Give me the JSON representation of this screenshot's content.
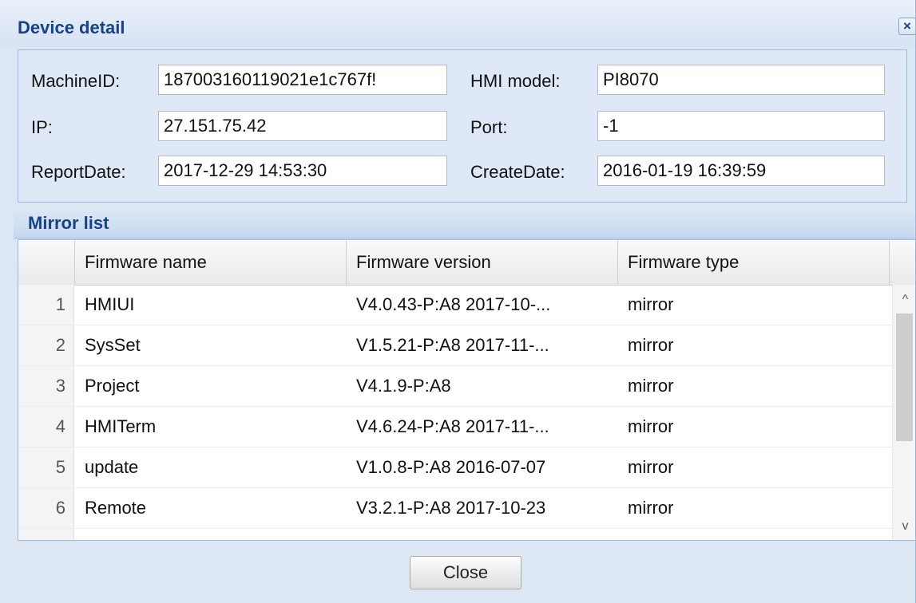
{
  "dialog": {
    "title": "Device detail",
    "close_icon": "×"
  },
  "details": {
    "machine_id_label": "MachineID:",
    "machine_id_value": "187003160119021e1c767f!",
    "hmi_model_label": "HMI model:",
    "hmi_model_value": "PI8070",
    "ip_label": "IP:",
    "ip_value": "27.151.75.42",
    "port_label": "Port:",
    "port_value": "-1",
    "report_date_label": "ReportDate:",
    "report_date_value": "2017-12-29 14:53:30",
    "create_date_label": "CreateDate:",
    "create_date_value": "2016-01-19 16:39:59"
  },
  "mirror_list": {
    "title": "Mirror list",
    "columns": [
      "Firmware name",
      "Firmware version",
      "Firmware type"
    ],
    "rows": [
      {
        "num": "1",
        "name": "HMIUI",
        "version": "V4.0.43-P:A8 2017-10-...",
        "type": "mirror"
      },
      {
        "num": "2",
        "name": "SysSet",
        "version": "V1.5.21-P:A8 2017-11-...",
        "type": "mirror"
      },
      {
        "num": "3",
        "name": "Project",
        "version": "V4.1.9-P:A8",
        "type": "mirror"
      },
      {
        "num": "4",
        "name": "HMITerm",
        "version": "V4.6.24-P:A8 2017-11-...",
        "type": "mirror"
      },
      {
        "num": "5",
        "name": "update",
        "version": "V1.0.8-P:A8 2016-07-07",
        "type": "mirror"
      },
      {
        "num": "6",
        "name": "Remote",
        "version": "V3.2.1-P:A8 2017-10-23",
        "type": "mirror"
      }
    ]
  },
  "footer": {
    "close_label": "Close"
  },
  "icons": {
    "scroll_up": "^",
    "scroll_down": "v"
  },
  "colors": {
    "title": "#15428b",
    "panel": "#dfe8f6",
    "border": "#99bbe8"
  }
}
